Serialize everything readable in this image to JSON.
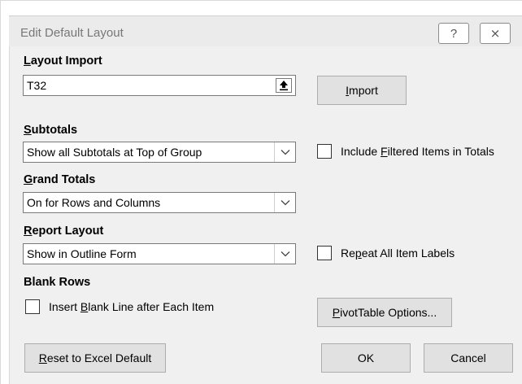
{
  "dialog": {
    "title": "Edit Default Layout",
    "help_glyph": "?",
    "close_glyph": "⨯"
  },
  "layout_import": {
    "label_key": "L",
    "label_rest": "ayout Import",
    "value": "T32",
    "import_key": "I",
    "import_rest": "mport"
  },
  "subtotals": {
    "label_key": "S",
    "label_rest": "ubtotals",
    "selected": "Show all Subtotals at Top of Group",
    "include_filtered_pre": "Include ",
    "include_filtered_key": "F",
    "include_filtered_post": "iltered Items in Totals"
  },
  "grand_totals": {
    "label_key": "G",
    "label_rest": "rand Totals",
    "selected": "On for Rows and Columns"
  },
  "report_layout": {
    "label_key": "R",
    "label_rest": "eport Layout",
    "selected": "Show in Outline Form",
    "repeat_pre": "Re",
    "repeat_key": "p",
    "repeat_post": "eat All Item Labels"
  },
  "blank_rows": {
    "label": "Blank Rows",
    "insert_pre": "Insert ",
    "insert_key": "B",
    "insert_post": "lank Line after Each Item",
    "pivot_key": "P",
    "pivot_rest": "ivotTable Options..."
  },
  "footer": {
    "reset_key": "R",
    "reset_rest": "eset to Excel Default",
    "ok": "OK",
    "cancel": "Cancel"
  }
}
